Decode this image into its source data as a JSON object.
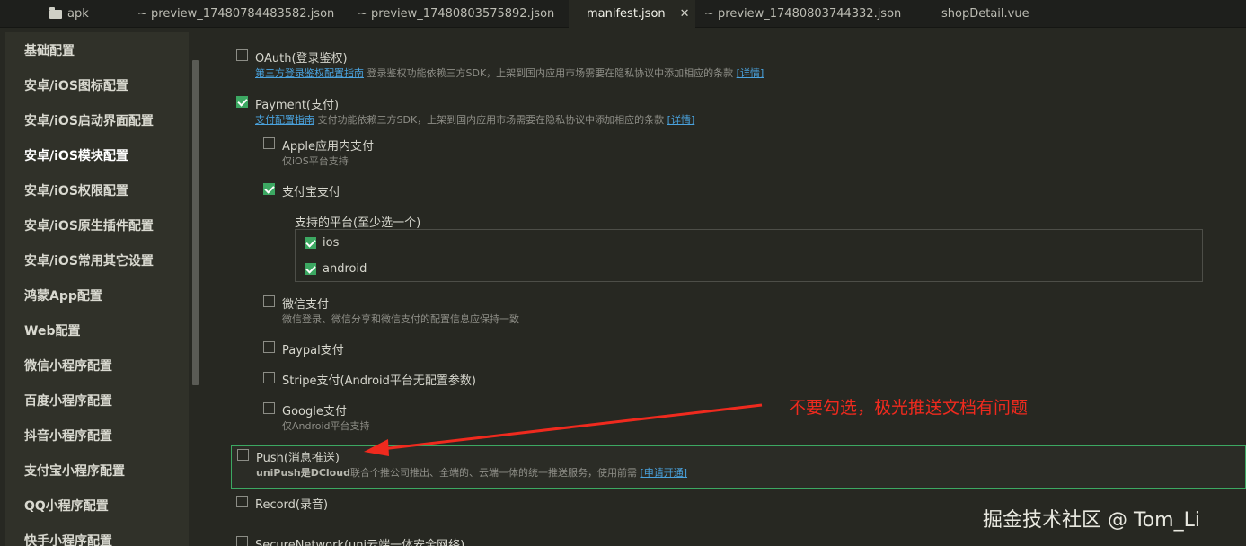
{
  "tabs": [
    {
      "label": "apk",
      "icon": "folder-icon",
      "active": false
    },
    {
      "label": "~ preview_17480784483582.json",
      "active": false
    },
    {
      "label": "~ preview_17480803575892.json",
      "active": false
    },
    {
      "label": "manifest.json",
      "active": true
    },
    {
      "label": "~ preview_17480803744332.json",
      "active": false
    },
    {
      "label": "shopDetail.vue",
      "active": false
    }
  ],
  "sidebar": {
    "items": [
      {
        "label": "基础配置"
      },
      {
        "label": "安卓/iOS图标配置"
      },
      {
        "label": "安卓/iOS启动界面配置"
      },
      {
        "label": "安卓/iOS模块配置",
        "active": true
      },
      {
        "label": "安卓/iOS权限配置"
      },
      {
        "label": "安卓/iOS原生插件配置"
      },
      {
        "label": "安卓/iOS常用其它设置"
      },
      {
        "label": "鸿蒙App配置"
      },
      {
        "label": "Web配置"
      },
      {
        "label": "微信小程序配置"
      },
      {
        "label": "百度小程序配置"
      },
      {
        "label": "抖音小程序配置"
      },
      {
        "label": "支付宝小程序配置"
      },
      {
        "label": "QQ小程序配置"
      },
      {
        "label": "快手小程序配置"
      }
    ]
  },
  "modules": {
    "oauth": {
      "label": "OAuth(登录鉴权)",
      "checked": false,
      "link": "第三方登录鉴权配置指南",
      "desc": " 登录鉴权功能依赖三方SDK，上架到国内应用市场需要在隐私协议中添加相应的条款 ",
      "detail": "[详情]"
    },
    "payment": {
      "label": "Payment(支付)",
      "checked": true,
      "link": "支付配置指南",
      "desc": " 支付功能依赖三方SDK，上架到国内应用市场需要在隐私协议中添加相应的条款 ",
      "detail": "[详情]",
      "apple": {
        "label": "Apple应用内支付",
        "checked": false,
        "desc": "仅iOS平台支持"
      },
      "alipay": {
        "label": "支付宝支付",
        "checked": true,
        "platforms_title": "支持的平台(至少选一个)",
        "ios": {
          "label": "ios",
          "checked": true
        },
        "android": {
          "label": "android",
          "checked": true
        }
      },
      "wechat": {
        "label": "微信支付",
        "checked": false,
        "desc": "微信登录、微信分享和微信支付的配置信息应保持一致"
      },
      "paypal": {
        "label": "Paypal支付",
        "checked": false
      },
      "stripe": {
        "label": "Stripe支付(Android平台无配置参数)",
        "checked": false
      },
      "google": {
        "label": "Google支付",
        "checked": false,
        "desc": "仅Android平台支持"
      }
    },
    "push": {
      "label": "Push(消息推送)",
      "checked": false,
      "desc_strong": "uniPush是DCloud",
      "desc": "联合个推公司推出、全端的、云端一体的统一推送服务，使用前需 ",
      "link": "[申请开通]"
    },
    "record": {
      "label": "Record(录音)",
      "checked": false
    },
    "securenetwork": {
      "label": "SecureNetwork(uni云端一体安全网络)",
      "checked": false
    }
  },
  "annotation": {
    "text": "不要勾选，极光推送文档有问题",
    "color": "#ef2a1e"
  },
  "watermark": {
    "text": "掘金技术社区 @ Tom_Li"
  },
  "colors": {
    "accent": "#3ca862",
    "link": "#4aa3df",
    "background": "#272822"
  }
}
